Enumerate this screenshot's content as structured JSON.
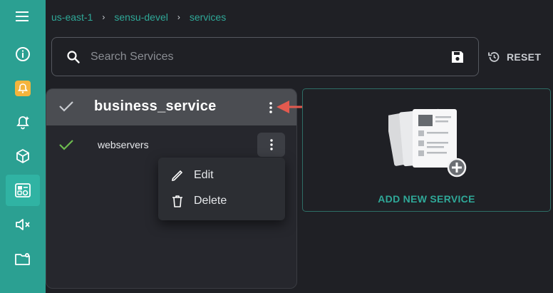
{
  "breadcrumb": [
    "us-east-1",
    "sensu-devel",
    "services"
  ],
  "breadcrumb_separator": "›",
  "search": {
    "placeholder": "Search Services"
  },
  "reset_label": "RESET",
  "service_card": {
    "title": "business_service",
    "children": [
      {
        "label": "webservers"
      }
    ]
  },
  "context_menu": {
    "edit_label": "Edit",
    "delete_label": "Delete"
  },
  "add_service_label": "ADD NEW SERVICE",
  "colors": {
    "accent": "#2ba092",
    "background": "#1f2025",
    "arrow": "#e35a4f",
    "check_green": "#6dbb4f"
  },
  "nav_icons": [
    "menu-icon",
    "info-icon",
    "silence-bell-icon",
    "bell-icon",
    "cube-icon",
    "services-icon",
    "mute-icon",
    "folder-settings-icon"
  ]
}
